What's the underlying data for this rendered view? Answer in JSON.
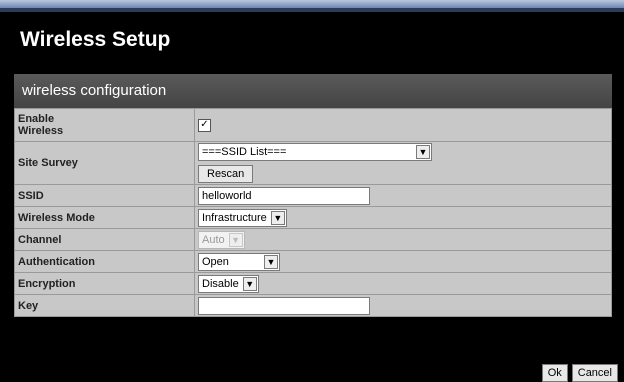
{
  "page": {
    "title": "Wireless Setup"
  },
  "panel": {
    "title": "wireless configuration"
  },
  "rows": {
    "enable": {
      "label_line1": "Enable",
      "label_line2": "Wireless",
      "checked": true
    },
    "site_survey": {
      "label": "Site Survey",
      "value": "===SSID List===",
      "rescan": "Rescan"
    },
    "ssid": {
      "label": "SSID",
      "value": "helloworld"
    },
    "mode": {
      "label": "Wireless Mode",
      "value": "Infrastructure"
    },
    "channel": {
      "label": "Channel",
      "value": "Auto"
    },
    "auth": {
      "label": "Authentication",
      "value": "Open"
    },
    "enc": {
      "label": "Encryption",
      "value": "Disable"
    },
    "key": {
      "label": "Key",
      "value": ""
    }
  },
  "buttons": {
    "ok": "Ok",
    "cancel": "Cancel"
  },
  "icons": {
    "dropdown_arrow": "chevron-down-icon",
    "check": "checkmark-icon"
  }
}
